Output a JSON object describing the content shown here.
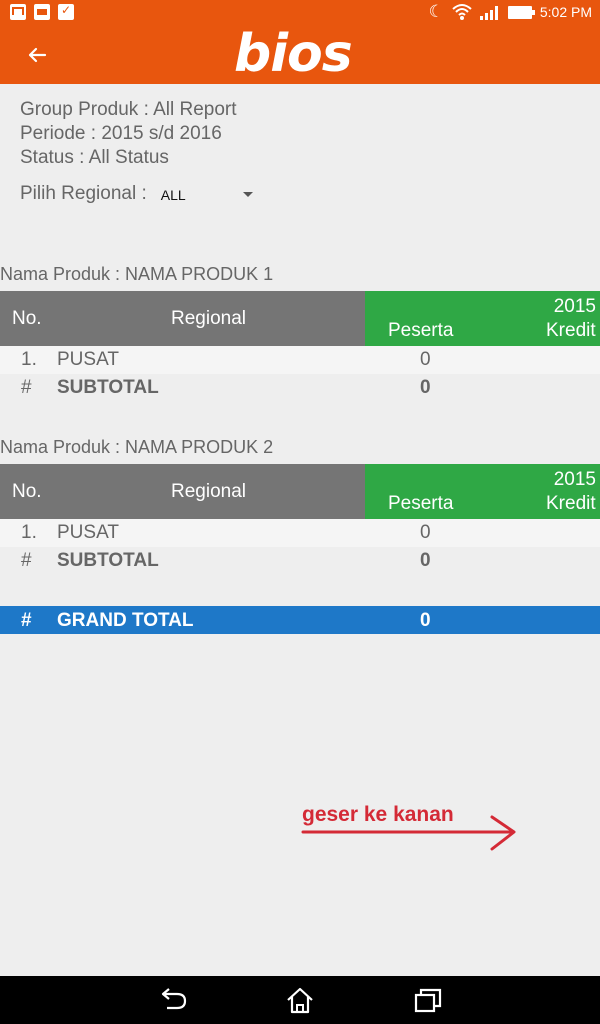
{
  "status_bar": {
    "time": "5:02 PM",
    "left_icons": [
      "mail-icon",
      "gallery-icon",
      "bag-icon"
    ],
    "right_icons": [
      "moon-icon",
      "wifi-icon",
      "signal-icon",
      "battery-icon"
    ]
  },
  "app_bar": {
    "back_icon": "arrow-left-icon",
    "logo_text": "bios",
    "color": "#e8560e"
  },
  "filters": {
    "group_produk": "Group Produk : All Report",
    "periode": "Periode : 2015 s/d 2016",
    "status": "Status : All Status",
    "regional_label": "Pilih Regional :",
    "regional_value": "ALL"
  },
  "table_header": {
    "no": "No.",
    "regional": "Regional",
    "year": "2015",
    "peserta": "Peserta",
    "kredit": "Kredit"
  },
  "products": [
    {
      "title": "Nama Produk : NAMA PRODUK 1",
      "rows": [
        {
          "no": "1.",
          "regional": "PUSAT",
          "peserta": "0"
        }
      ],
      "subtotal": {
        "symbol": "#",
        "label": "SUBTOTAL",
        "value": "0"
      }
    },
    {
      "title": "Nama Produk : NAMA PRODUK 2",
      "rows": [
        {
          "no": "1.",
          "regional": "PUSAT",
          "peserta": "0"
        }
      ],
      "subtotal": {
        "symbol": "#",
        "label": "SUBTOTAL",
        "value": "0"
      }
    }
  ],
  "grand_total": {
    "symbol": "#",
    "label": "GRAND TOTAL",
    "value": "0"
  },
  "hint": "geser ke kanan",
  "nav_bar": [
    "back-icon",
    "home-icon",
    "recents-icon"
  ],
  "colors": {
    "header_gray": "#757575",
    "header_green": "#2fa845",
    "grand_total_blue": "#1e78c8",
    "hint_red": "#d42a36"
  }
}
